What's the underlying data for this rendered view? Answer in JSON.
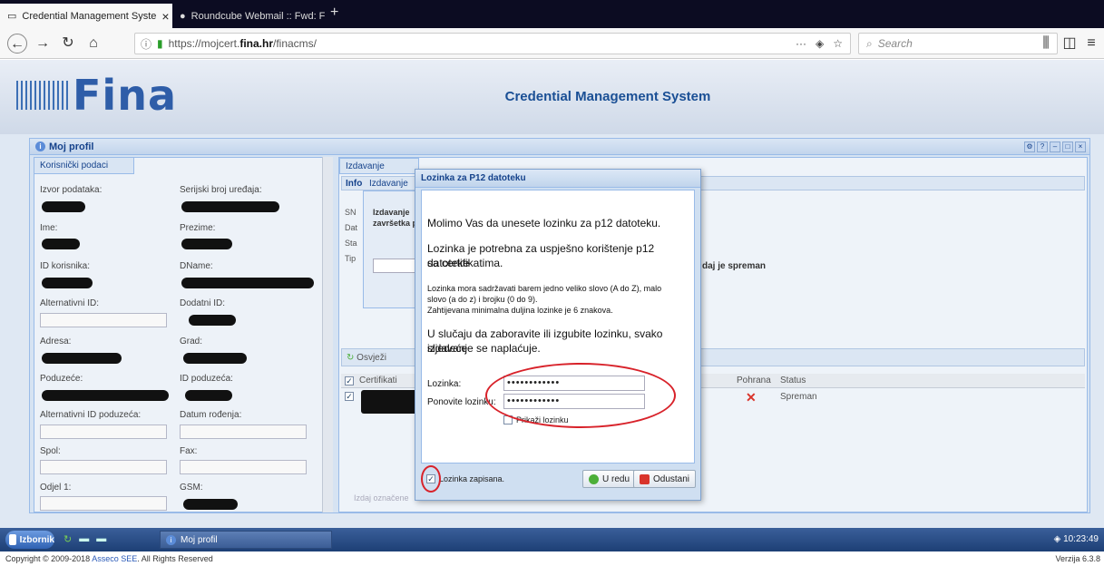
{
  "browser": {
    "tabs": [
      {
        "label": "Credential Management Syste",
        "close": "×"
      },
      {
        "label": "Roundcube Webmail :: Fwd: Fw",
        "close": "×"
      }
    ],
    "new_tab": "+",
    "url_prefix": "https://mojcert.",
    "url_domain": "fina.hr",
    "url_suffix": "/finacms/",
    "search_placeholder": "Search",
    "page_actions": "···"
  },
  "header": {
    "logo_text": "Fina",
    "app_title": "Credential Management System"
  },
  "window": {
    "title": "Moj profil",
    "left_tab": "Korisnički podaci",
    "fields": [
      {
        "label": "Izvor podataka:"
      },
      {
        "label": "Serijski broj uređaja:"
      },
      {
        "label": "Ime:"
      },
      {
        "label": "Prezime:"
      },
      {
        "label": "ID korisnika:"
      },
      {
        "label": "DName:"
      },
      {
        "label": "Alternativni ID:"
      },
      {
        "label": "Dodatni ID:"
      },
      {
        "label": "Adresa:"
      },
      {
        "label": "Grad:"
      },
      {
        "label": "Poduzeće:"
      },
      {
        "label": "ID poduzeća:"
      },
      {
        "label": "Alternativni ID poduzeća:"
      },
      {
        "label": "Datum rođenja:"
      },
      {
        "label": "Spol:"
      },
      {
        "label": "Fax:"
      },
      {
        "label": "Odjel 1:"
      },
      {
        "label": "GSM:"
      }
    ],
    "right_tab": "Izdavanje",
    "info_tab": "Info",
    "inner_tab": "Izdavanje",
    "inner_text_1": "Izdavanje",
    "inner_text_2": "završetka p",
    "inner_labels": [
      "SN",
      "Dat",
      "Sta",
      "Tip"
    ],
    "status_fragment": "daj je spreman",
    "refresh_label": "Osvježi",
    "grid_headers": {
      "col1": "Certifikati",
      "pohrana": "Pohrana",
      "status": "Status"
    },
    "grid_row": {
      "pohrana_icon": "✕",
      "status": "Spreman"
    },
    "bottom_fragment": "Izdaj označene"
  },
  "dialog": {
    "title": "Lozinka za P12 datoteku",
    "line1": "Molimo Vas da unesete lozinku za p12 datoteku.",
    "line2a": "Lozinka je potrebna za uspješno korištenje p12 datoteke",
    "line2b": "sa certifikatima.",
    "rule1a": "Lozinka mora sadržavati barem jedno veliko slovo (A do Z), malo",
    "rule1b": "slovo (a do z) i brojku (0 do 9).",
    "rule2": "Zahtijevana minimalna duljina lozinke je 6 znakova.",
    "warn1": "U slučaju da zaboravite ili izgubite lozinku, svako sljedeće",
    "warn2": "izdavanje se naplaćuje.",
    "password_label": "Lozinka:",
    "password_value": "••••••••••••",
    "repeat_label": "Ponovite lozinku:",
    "repeat_value": "••••••••••••",
    "show_label": "Prikaži lozinku",
    "saved_label": "Lozinka zapisana.",
    "ok_label": "U redu",
    "cancel_label": "Odustani"
  },
  "taskbar": {
    "start_label": "Izbornik",
    "task_label": "Moj profil",
    "clock": "10:23:49"
  },
  "footer": {
    "copyright_prefix": "Copyright © 2009-2018",
    "company": "Asseco SEE",
    "copyright_suffix": "All Rights Reserved",
    "version": "Verzija 6.3.8"
  },
  "colors": {
    "brand": "#2e5da8",
    "accent": "#15428b",
    "highlight_ring": "#d8222a"
  }
}
